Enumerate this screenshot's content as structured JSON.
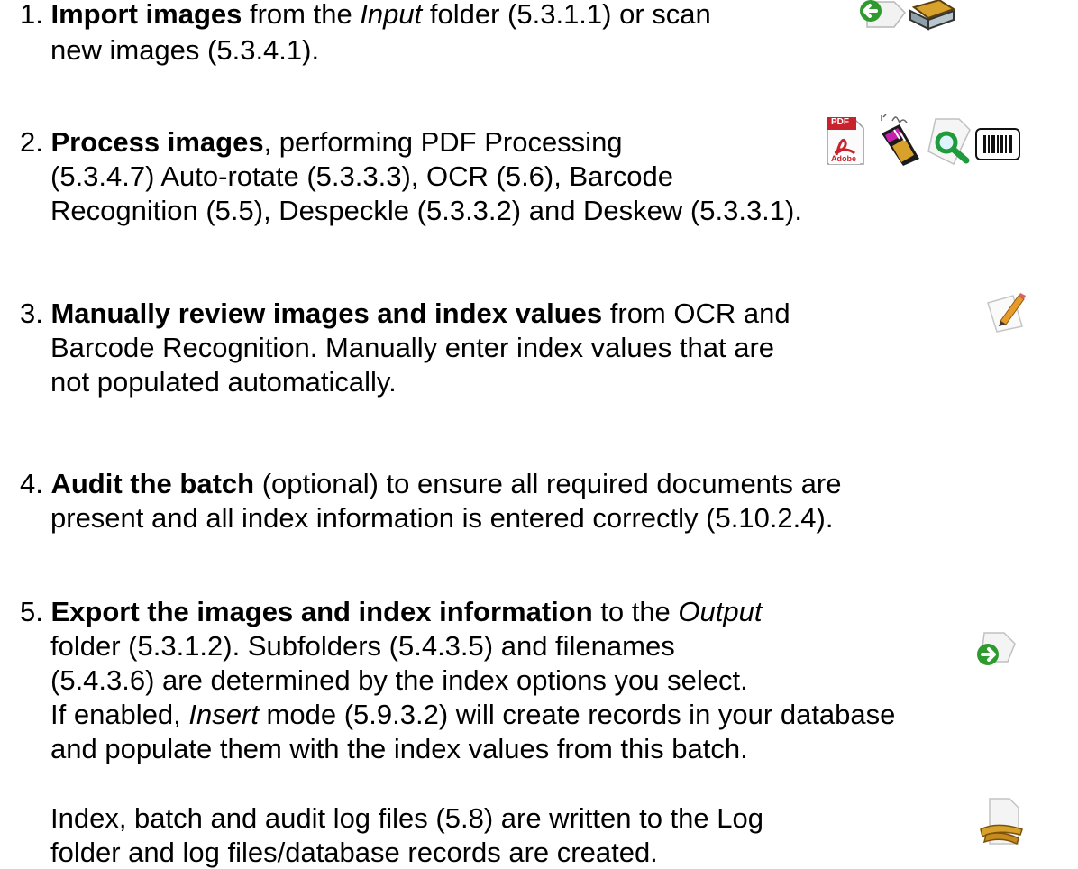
{
  "steps": [
    {
      "number": "1.",
      "line1": {
        "bold": "Import images",
        "t1": " from the ",
        "ital": "Input",
        "t2": " folder (5.3.1.1) or scan"
      },
      "line2": "new images (5.3.4.1).",
      "icons": [
        "import-arrow-icon",
        "scanner-icon"
      ]
    },
    {
      "number": "2.",
      "line1": {
        "bold": "Process images",
        "t1": ", performing PDF Processing"
      },
      "line2": "(5.3.4.7) Auto-rotate (5.3.3.3), OCR (5.6), Barcode",
      "line3": "Recognition (5.5), Despeckle (5.3.3.2) and Deskew (5.3.3.1).",
      "icons": [
        "pdf-icon",
        "process-wand-icon",
        "magnifier-document-icon",
        "barcode-icon"
      ],
      "pdf_label": "PDF",
      "adobe_label": "Adobe"
    },
    {
      "number": "3.",
      "line1": {
        "bold": "Manually review images and index values",
        "t1": " from OCR and"
      },
      "line2": "Barcode Recognition.  Manually enter index values that are",
      "line3": "not populated automatically.",
      "icons": [
        "pencil-edit-icon"
      ]
    },
    {
      "number": "4.",
      "line1": {
        "bold": "Audit the batch",
        "t1": " (optional) to ensure all required documents are"
      },
      "line2": "present and all index information is entered correctly (5.10.2.4).",
      "icons": []
    },
    {
      "number": "5.",
      "line1": {
        "bold": "Export the images and index information",
        "t1": " to the ",
        "ital": "Output"
      },
      "line2": "folder (5.3.1.2).  Subfolders (5.4.3.5) and filenames",
      "line3": "(5.4.3.6) are determined by the index options you select.",
      "line4": {
        "t1": "If enabled, ",
        "ital": "Insert",
        "t2": " mode (5.9.3.2) will create records in your database"
      },
      "line5": "and populate them with the index values from this batch.",
      "icons": [
        "export-arrow-icon"
      ]
    }
  ],
  "note": {
    "line1": "Index, batch and audit log files (5.8) are written to the Log",
    "line2": "folder and log files/database records are created.",
    "icons": [
      "log-file-icon"
    ]
  },
  "colors": {
    "accent_green": "#2e9b2e",
    "icon_gold": "#d8a12b",
    "pdf_red": "#c8232c"
  }
}
